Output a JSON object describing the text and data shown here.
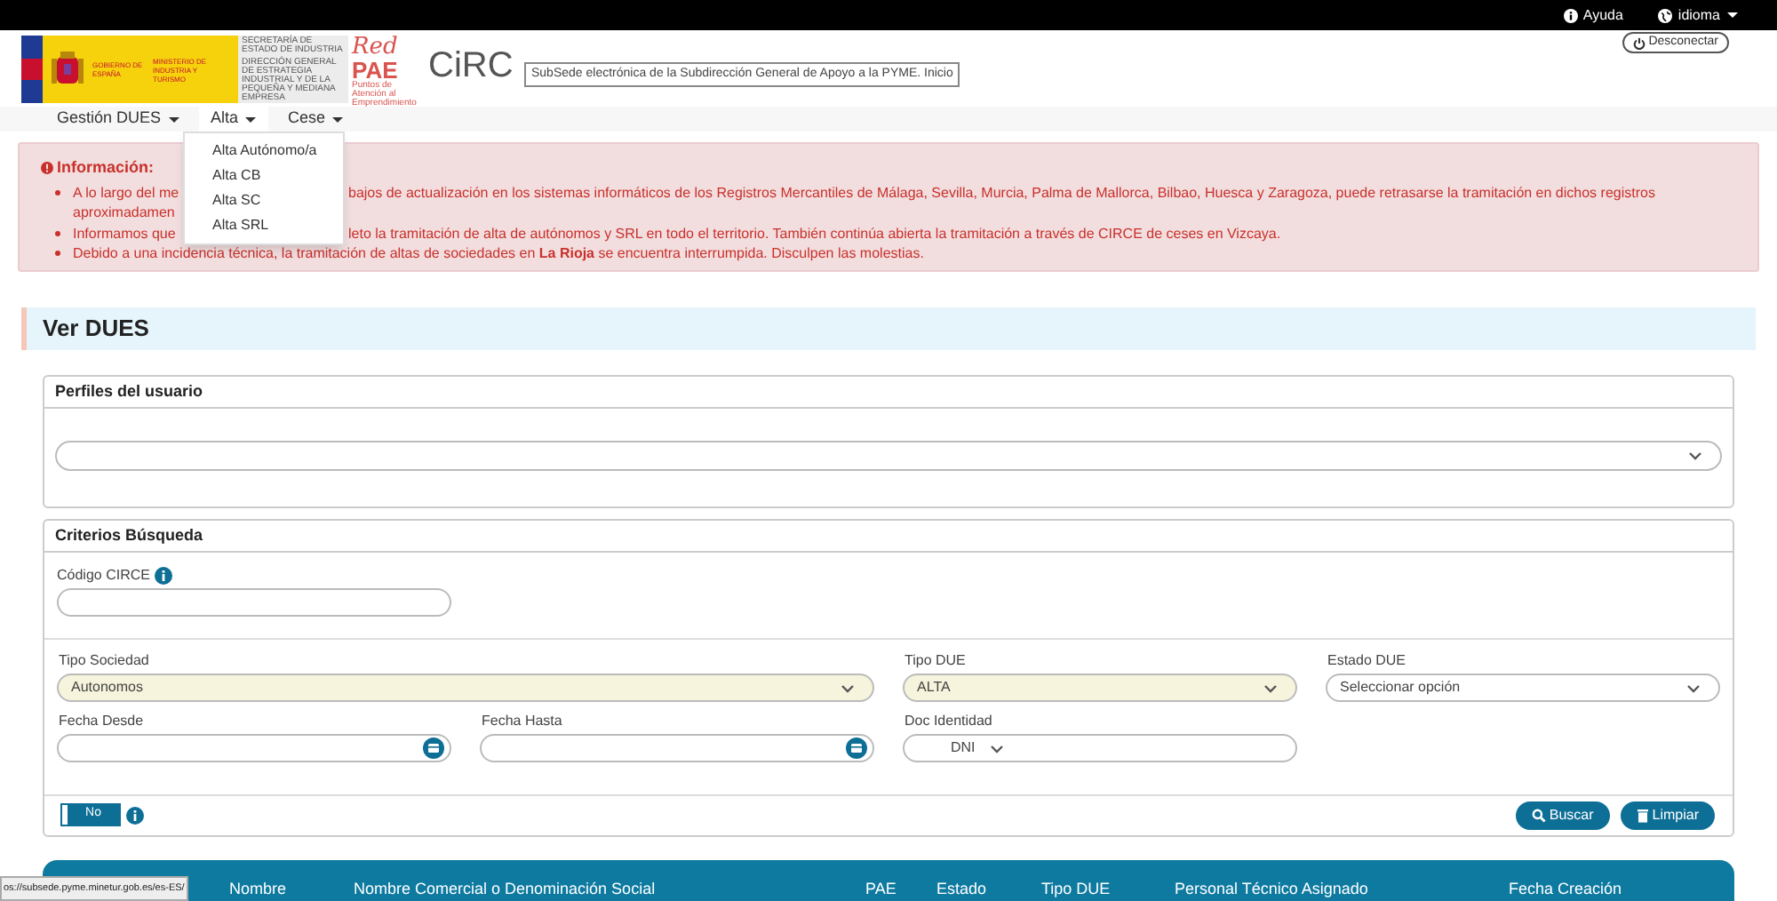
{
  "top_bar": {
    "links": [
      {
        "label": "Ayuda",
        "kind": "help"
      },
      {
        "label": "idioma",
        "kind": "language"
      }
    ]
  },
  "header": {
    "government_logo": {
      "government": "GOBIERNO DE ESPAÑA",
      "ministry": "MINISTERIO DE INDUSTRIA Y TURISMO",
      "secretariat": "SECRETARÍA DE ESTADO DE INDUSTRIA",
      "directorate": "DIRECCIÓN GENERAL DE ESTRATEGIA INDUSTRIAL Y DE LA PEQUEÑA Y MEDIANA EMPRESA"
    },
    "red_pae_logo": {
      "line_1": "Red",
      "line_2": "PAE",
      "caption": "Puntos de Atención al Emprendimiento"
    },
    "circe_logo": "CiRC",
    "tooltip": "SubSede electrónica de la Subdirección General de Apoyo a la PYME. Inicio",
    "logout_button": "Desconectar"
  },
  "nav": {
    "items": [
      {
        "label": "Gestión DUES",
        "expanded": false
      },
      {
        "label": "Alta",
        "expanded": true,
        "menu": [
          "Alta Autónomo/a",
          "Alta CB",
          "Alta SC",
          "Alta SRL"
        ]
      },
      {
        "label": "Cese",
        "expanded": false
      }
    ]
  },
  "alert": {
    "title": "Información:",
    "bullets": [
      {
        "lines": [
          [
            "A lo largo del me",
            "bajos de actualización en los sistemas informáticos de los Registros Mercantiles de Málaga, Sevilla, Murcia, Palma de Mallorca, Bilbao, Huesca y Zaragoza, puede retrasarse la tramitación en dichos registros"
          ],
          [
            "aproximadamen"
          ]
        ]
      },
      {
        "lines": [
          [
            "Informamos que",
            "leto la tramitación de alta de autónomos y SRL en todo el territorio. También continúa abierta la tramitación a través de CIRCE de ceses en Vizcaya."
          ]
        ]
      },
      {
        "lines": [
          [
            "Debido a una incidencia técnica, la tramitación de altas de sociedades en **La Rioja** se encuentra interrumpida. Disculpen las molestias."
          ]
        ]
      }
    ]
  },
  "page_title": "Ver DUES",
  "profiles_panel": {
    "title": "Perfiles del usuario"
  },
  "search_panel": {
    "title": "Criterios Búsqueda",
    "code_field": {
      "label": "Código CIRCE"
    },
    "fields": [
      {
        "kind": "select",
        "label": "Tipo Sociedad",
        "value": "Autonomos",
        "highlighted": true
      },
      {
        "kind": "select",
        "label": "Tipo DUE",
        "value": "ALTA",
        "highlighted": true
      },
      {
        "kind": "select",
        "label": "Estado DUE",
        "value": "Seleccionar opción",
        "highlighted": false
      },
      {
        "kind": "date",
        "label": "Fecha Desde"
      },
      {
        "kind": "date",
        "label": "Fecha Hasta"
      },
      {
        "kind": "document",
        "label": "Doc Identidad",
        "doc_type": "DNI"
      }
    ],
    "toggle": {
      "label": "No",
      "on": false
    },
    "buttons": [
      {
        "label": "Buscar",
        "kind": "search"
      },
      {
        "label": "Limpiar",
        "kind": "clear"
      }
    ]
  },
  "results_table": {
    "columns": [
      "Nombre",
      "Nombre Comercial o Denominación Social",
      "PAE",
      "Estado",
      "Tipo DUE",
      "Personal Técnico Asignado",
      "Fecha Creación"
    ]
  },
  "status_url": "os://subsede.pyme.minetur.gob.es/es-ES/"
}
